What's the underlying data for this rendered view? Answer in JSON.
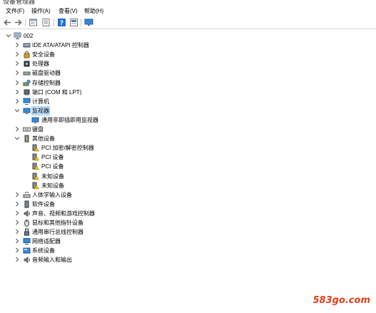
{
  "window": {
    "title": "设备管理器"
  },
  "menu": [
    {
      "label": "文件(F)"
    },
    {
      "label": "操作(A)"
    },
    {
      "label": "查看(V)"
    },
    {
      "label": "帮助(H)"
    }
  ],
  "toolbar": {
    "buttons": [
      {
        "icon": "back-arrow-icon"
      },
      {
        "icon": "forward-arrow-icon"
      },
      {
        "icon": "properties-icon"
      },
      {
        "icon": "list-view-icon"
      },
      {
        "icon": "help-icon"
      },
      {
        "icon": "update-driver-icon"
      },
      {
        "icon": "monitor-scan-icon"
      }
    ]
  },
  "tree": {
    "root": {
      "label": "002",
      "icon": "computer-icon"
    },
    "items": [
      {
        "label": "IDE ATA/ATAPI 控制器",
        "icon": "ide-controller-icon",
        "level": 1,
        "expand": "collapsed"
      },
      {
        "label": "安全设备",
        "icon": "security-device-icon",
        "level": 1,
        "expand": "collapsed"
      },
      {
        "label": "处理器",
        "icon": "processor-icon",
        "level": 1,
        "expand": "collapsed"
      },
      {
        "label": "磁盘驱动器",
        "icon": "disk-drive-icon",
        "level": 1,
        "expand": "collapsed"
      },
      {
        "label": "存储控制器",
        "icon": "storage-controller-icon",
        "level": 1,
        "expand": "collapsed"
      },
      {
        "label": "端口 (COM 和 LPT)",
        "icon": "port-icon",
        "level": 1,
        "expand": "collapsed"
      },
      {
        "label": "计算机",
        "icon": "computer-category-icon",
        "level": 1,
        "expand": "collapsed"
      },
      {
        "label": "监视器",
        "icon": "monitor-icon",
        "level": 1,
        "expand": "expanded",
        "selected": true
      },
      {
        "label": "通用非即插即用监视器",
        "icon": "monitor-icon",
        "level": 2,
        "expand": "none"
      },
      {
        "label": "键盘",
        "icon": "keyboard-icon",
        "level": 1,
        "expand": "collapsed"
      },
      {
        "label": "其他设备",
        "icon": "other-devices-icon",
        "level": 1,
        "expand": "expanded"
      },
      {
        "label": "PCI 加密/解密控制器",
        "icon": "unknown-device-warning-icon",
        "level": 2,
        "expand": "none"
      },
      {
        "label": "PCI 设备",
        "icon": "unknown-device-warning-icon",
        "level": 2,
        "expand": "none"
      },
      {
        "label": "PCI 设备",
        "icon": "unknown-device-warning-icon",
        "level": 2,
        "expand": "none"
      },
      {
        "label": "未知设备",
        "icon": "unknown-device-warning-icon",
        "level": 2,
        "expand": "none"
      },
      {
        "label": "未知设备",
        "icon": "unknown-device-warning-icon",
        "level": 2,
        "expand": "none"
      },
      {
        "label": "人体学输入设备",
        "icon": "hid-icon",
        "level": 1,
        "expand": "collapsed"
      },
      {
        "label": "软件设备",
        "icon": "software-device-icon",
        "level": 1,
        "expand": "collapsed"
      },
      {
        "label": "声音、视频和游戏控制器",
        "icon": "sound-icon",
        "level": 1,
        "expand": "collapsed"
      },
      {
        "label": "鼠标和其他指针设备",
        "icon": "mouse-icon",
        "level": 1,
        "expand": "collapsed"
      },
      {
        "label": "通用串行总线控制器",
        "icon": "usb-icon",
        "level": 1,
        "expand": "collapsed"
      },
      {
        "label": "网络适配器",
        "icon": "network-adapter-icon",
        "level": 1,
        "expand": "collapsed"
      },
      {
        "label": "系统设备",
        "icon": "system-device-icon",
        "level": 1,
        "expand": "collapsed"
      },
      {
        "label": "音频输入和输出",
        "icon": "audio-io-icon",
        "level": 1,
        "expand": "collapsed"
      }
    ]
  },
  "watermark": {
    "text": "583go.com"
  },
  "colors": {
    "selection": "#cce8ff",
    "warning": "#f5c400",
    "watermark": "#e0401b"
  }
}
